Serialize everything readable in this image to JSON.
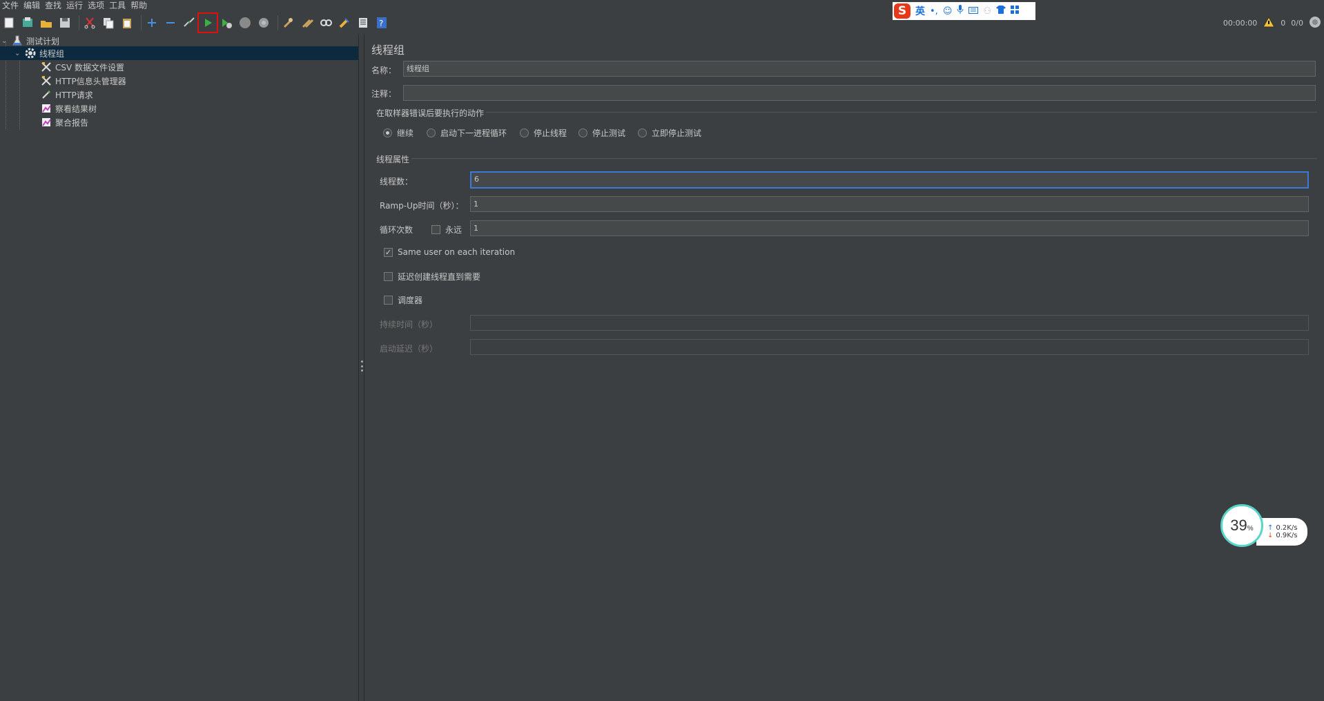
{
  "menu": [
    "文件",
    "编辑",
    "查找",
    "运行",
    "选项",
    "工具",
    "帮助"
  ],
  "toolbar": {
    "elapsed": "00:00:00",
    "warnings": "0",
    "threads": "0/0"
  },
  "ime": {
    "logo": "S",
    "lang": "英"
  },
  "tree": {
    "root": "测试计划",
    "thread_group": "线程组",
    "children": [
      "CSV 数据文件设置",
      "HTTP信息头管理器",
      "HTTP请求",
      "察看结果树",
      "聚合报告"
    ]
  },
  "panel": {
    "title": "线程组",
    "name_label": "名称：",
    "name_value": "线程组",
    "comment_label": "注释：",
    "comment_value": "",
    "error_group_title": "在取样器错误后要执行的动作",
    "error_actions": [
      "继续",
      "启动下一进程循环",
      "停止线程",
      "停止测试",
      "立即停止测试"
    ],
    "error_selected": 0,
    "props_title": "线程属性",
    "threads_label": "线程数：",
    "threads_value": "6",
    "rampup_label": "Ramp-Up时间（秒）：",
    "rampup_value": "1",
    "loop_label": "循环次数",
    "forever_label": "永远",
    "loop_value": "1",
    "same_user_label": "Same user on each iteration",
    "delay_label": "延迟创建线程直到需要",
    "scheduler_label": "调度器",
    "duration_label": "持续时间（秒）",
    "duration_value": "",
    "startup_label": "启动延迟（秒）",
    "startup_value": ""
  },
  "net": {
    "percent": "39",
    "percent_unit": "%",
    "up": "0.2",
    "down": "0.9",
    "unit": "K/s"
  }
}
